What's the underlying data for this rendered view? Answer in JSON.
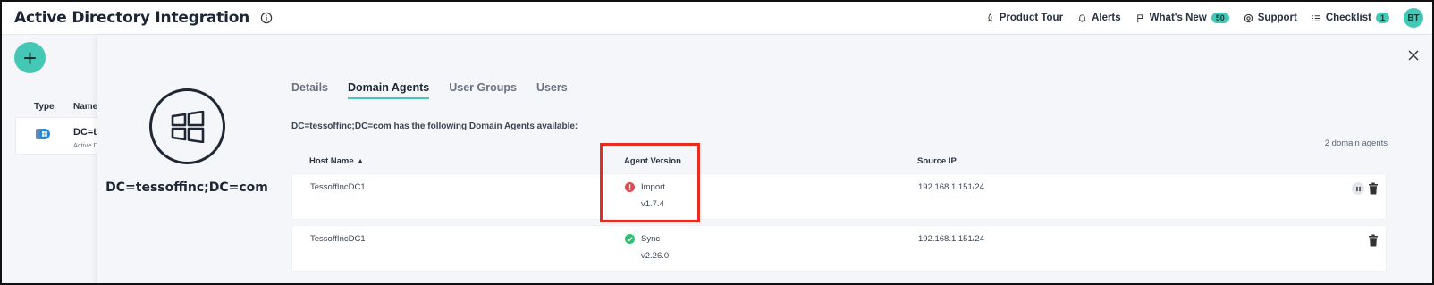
{
  "header": {
    "title": "Active Directory Integration",
    "nav": [
      {
        "label": "Product Tour",
        "icon": "rocket-icon"
      },
      {
        "label": "Alerts",
        "icon": "bell-icon"
      },
      {
        "label": "What's New",
        "icon": "flag-icon",
        "badge": "50"
      },
      {
        "label": "Support",
        "icon": "lifebuoy-icon"
      },
      {
        "label": "Checklist",
        "icon": "list-icon",
        "badge": "1"
      }
    ],
    "avatar": "BT"
  },
  "background_list": {
    "add_label": "+",
    "columns": [
      "Type",
      "Name"
    ],
    "row": {
      "name": "DC=te",
      "sub": "Active D"
    }
  },
  "panel": {
    "entity_name": "DC=tessoffinc;DC=com",
    "tabs": [
      {
        "label": "Details",
        "active": false
      },
      {
        "label": "Domain Agents",
        "active": true
      },
      {
        "label": "User Groups",
        "active": false
      },
      {
        "label": "Users",
        "active": false
      }
    ],
    "description": "DC=tessoffinc;DC=com has the following Domain Agents available:",
    "agent_count": "2 domain agents",
    "columns": {
      "host": "Host Name",
      "sort_indicator": "▲",
      "version": "Agent Version",
      "ip": "Source IP"
    },
    "rows": [
      {
        "host": "TessoffIncDC1",
        "status": "Import",
        "status_type": "error",
        "version": "v1.7.4",
        "ip": "192.168.1.151/24",
        "has_pause": true
      },
      {
        "host": "TessoffIncDC1",
        "status": "Sync",
        "status_type": "success",
        "version": "v2.26.0",
        "ip": "192.168.1.151/24",
        "has_pause": false
      }
    ]
  },
  "colors": {
    "accent": "#45c7b6",
    "error": "#e5484d",
    "success": "#2fbf71",
    "highlight": "#e82c1f"
  }
}
